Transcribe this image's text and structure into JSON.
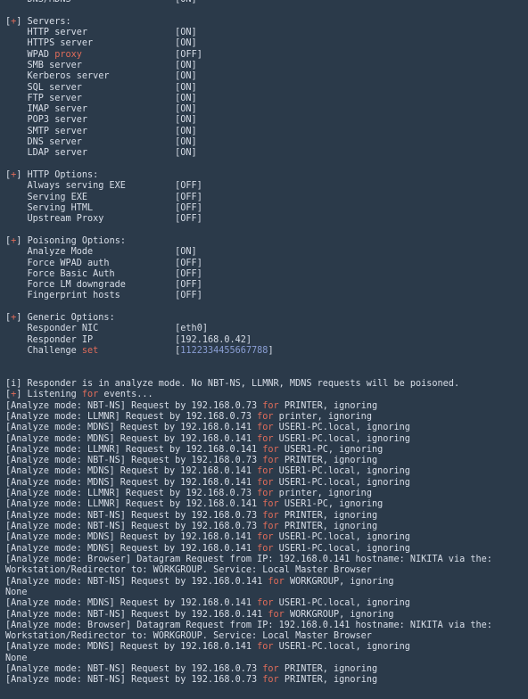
{
  "terminal": {
    "app_name": "Responder",
    "background_color": "#2b3a4a",
    "text_color": "#d8dee8",
    "keyword_color": "#e06c5a",
    "number_color": "#8a9ed4",
    "font_size_px": 10.2,
    "line_height_px": 12.32,
    "columns": 96,
    "clipped_first_line": true
  },
  "top_clipped": {
    "label": "DNS/MDNS",
    "value": "[ON]"
  },
  "sections": [
    {
      "prefix_open": "[",
      "prefix_symbol": "+",
      "prefix_close": "]",
      "title": "Servers:",
      "rows": [
        {
          "label": "HTTP server",
          "keyword": "",
          "value": "[ON]"
        },
        {
          "label": "HTTPS server",
          "keyword": "",
          "value": "[ON]"
        },
        {
          "label": "WPAD",
          "keyword": "proxy",
          "value": "[OFF]"
        },
        {
          "label": "SMB server",
          "keyword": "",
          "value": "[ON]"
        },
        {
          "label": "Kerberos server",
          "keyword": "",
          "value": "[ON]"
        },
        {
          "label": "SQL server",
          "keyword": "",
          "value": "[ON]"
        },
        {
          "label": "FTP server",
          "keyword": "",
          "value": "[ON]"
        },
        {
          "label": "IMAP server",
          "keyword": "",
          "value": "[ON]"
        },
        {
          "label": "POP3 server",
          "keyword": "",
          "value": "[ON]"
        },
        {
          "label": "SMTP server",
          "keyword": "",
          "value": "[ON]"
        },
        {
          "label": "DNS server",
          "keyword": "",
          "value": "[ON]"
        },
        {
          "label": "LDAP server",
          "keyword": "",
          "value": "[ON]"
        }
      ]
    },
    {
      "prefix_open": "[",
      "prefix_symbol": "+",
      "prefix_close": "]",
      "title": "HTTP Options:",
      "rows": [
        {
          "label": "Always serving EXE",
          "keyword": "",
          "value": "[OFF]"
        },
        {
          "label": "Serving EXE",
          "keyword": "",
          "value": "[OFF]"
        },
        {
          "label": "Serving HTML",
          "keyword": "",
          "value": "[OFF]"
        },
        {
          "label": "Upstream Proxy",
          "keyword": "",
          "value": "[OFF]"
        }
      ]
    },
    {
      "prefix_open": "[",
      "prefix_symbol": "+",
      "prefix_close": "]",
      "title": "Poisoning Options:",
      "rows": [
        {
          "label": "Analyze Mode",
          "keyword": "",
          "value": "[ON]"
        },
        {
          "label": "Force WPAD auth",
          "keyword": "",
          "value": "[OFF]"
        },
        {
          "label": "Force Basic Auth",
          "keyword": "",
          "value": "[OFF]"
        },
        {
          "label": "Force LM downgrade",
          "keyword": "",
          "value": "[OFF]"
        },
        {
          "label": "Fingerprint hosts",
          "keyword": "",
          "value": "[OFF]"
        }
      ]
    },
    {
      "prefix_open": "[",
      "prefix_symbol": "+",
      "prefix_close": "]",
      "title": "Generic Options:",
      "rows": [
        {
          "label": "Responder NIC",
          "keyword": "",
          "value": "[eth0]"
        },
        {
          "label": "Responder IP",
          "keyword": "",
          "value": "[192.168.0.42]"
        },
        {
          "label": "Challenge",
          "keyword": "set",
          "value": "[1122334455667788]",
          "value_is_number": true
        }
      ]
    }
  ],
  "status": {
    "info_prefix": "[i]",
    "info_text": "Responder is in analyze mode. No NBT-NS, LLMNR, MDNS requests will be poisoned.",
    "listening_prefix_open": "[",
    "listening_prefix_symbol": "+",
    "listening_prefix_close": "]",
    "listening_pre": " Listening ",
    "listening_keyword": "for",
    "listening_post": " events..."
  },
  "log_lines": [
    {
      "type": "request",
      "pre": "[Analyze mode: NBT-NS] Request by 192.168.0.73 ",
      "keyword": "for",
      "post": " PRINTER, ignoring"
    },
    {
      "type": "request",
      "pre": "[Analyze mode: LLMNR] Request by 192.168.0.73 ",
      "keyword": "for",
      "post": " printer, ignoring"
    },
    {
      "type": "request",
      "pre": "[Analyze mode: MDNS] Request by 192.168.0.141 ",
      "keyword": "for",
      "post": " USER1-PC.local, ignoring"
    },
    {
      "type": "request",
      "pre": "[Analyze mode: MDNS] Request by 192.168.0.141 ",
      "keyword": "for",
      "post": " USER1-PC.local, ignoring"
    },
    {
      "type": "request",
      "pre": "[Analyze mode: LLMNR] Request by 192.168.0.141 ",
      "keyword": "for",
      "post": " USER1-PC, ignoring"
    },
    {
      "type": "request",
      "pre": "[Analyze mode: NBT-NS] Request by 192.168.0.73 ",
      "keyword": "for",
      "post": " PRINTER, ignoring"
    },
    {
      "type": "request",
      "pre": "[Analyze mode: MDNS] Request by 192.168.0.141 ",
      "keyword": "for",
      "post": " USER1-PC.local, ignoring"
    },
    {
      "type": "request",
      "pre": "[Analyze mode: MDNS] Request by 192.168.0.141 ",
      "keyword": "for",
      "post": " USER1-PC.local, ignoring"
    },
    {
      "type": "request",
      "pre": "[Analyze mode: LLMNR] Request by 192.168.0.73 ",
      "keyword": "for",
      "post": " printer, ignoring"
    },
    {
      "type": "request",
      "pre": "[Analyze mode: LLMNR] Request by 192.168.0.141 ",
      "keyword": "for",
      "post": " USER1-PC, ignoring"
    },
    {
      "type": "request",
      "pre": "[Analyze mode: NBT-NS] Request by 192.168.0.73 ",
      "keyword": "for",
      "post": " PRINTER, ignoring"
    },
    {
      "type": "request",
      "pre": "[Analyze mode: NBT-NS] Request by 192.168.0.73 ",
      "keyword": "for",
      "post": " PRINTER, ignoring"
    },
    {
      "type": "request",
      "pre": "[Analyze mode: MDNS] Request by 192.168.0.141 ",
      "keyword": "for",
      "post": " USER1-PC.local, ignoring"
    },
    {
      "type": "request",
      "pre": "[Analyze mode: MDNS] Request by 192.168.0.141 ",
      "keyword": "for",
      "post": " USER1-PC.local, ignoring"
    },
    {
      "type": "plain",
      "text": "[Analyze mode: Browser] Datagram Request from IP: 192.168.0.141 hostname: NIKITA via the:"
    },
    {
      "type": "plain",
      "text": "Workstation/Redirector to: WORKGROUP. Service: Local Master Browser"
    },
    {
      "type": "request",
      "pre": "[Analyze mode: NBT-NS] Request by 192.168.0.141 ",
      "keyword": "for",
      "post": " WORKGROUP, ignoring"
    },
    {
      "type": "plain",
      "text": "None"
    },
    {
      "type": "request",
      "pre": "[Analyze mode: MDNS] Request by 192.168.0.141 ",
      "keyword": "for",
      "post": " USER1-PC.local, ignoring"
    },
    {
      "type": "request",
      "pre": "[Analyze mode: NBT-NS] Request by 192.168.0.141 ",
      "keyword": "for",
      "post": " WORKGROUP, ignoring"
    },
    {
      "type": "plain",
      "text": "[Analyze mode: Browser] Datagram Request from IP: 192.168.0.141 hostname: NIKITA via the:"
    },
    {
      "type": "plain",
      "text": "Workstation/Redirector to: WORKGROUP. Service: Local Master Browser"
    },
    {
      "type": "request",
      "pre": "[Analyze mode: MDNS] Request by 192.168.0.141 ",
      "keyword": "for",
      "post": " USER1-PC.local, ignoring"
    },
    {
      "type": "plain",
      "text": "None"
    },
    {
      "type": "request",
      "pre": "[Analyze mode: NBT-NS] Request by 192.168.0.73 ",
      "keyword": "for",
      "post": " PRINTER, ignoring"
    },
    {
      "type": "request",
      "pre": "[Analyze mode: NBT-NS] Request by 192.168.0.73 ",
      "keyword": "for",
      "post": " PRINTER, ignoring"
    }
  ]
}
